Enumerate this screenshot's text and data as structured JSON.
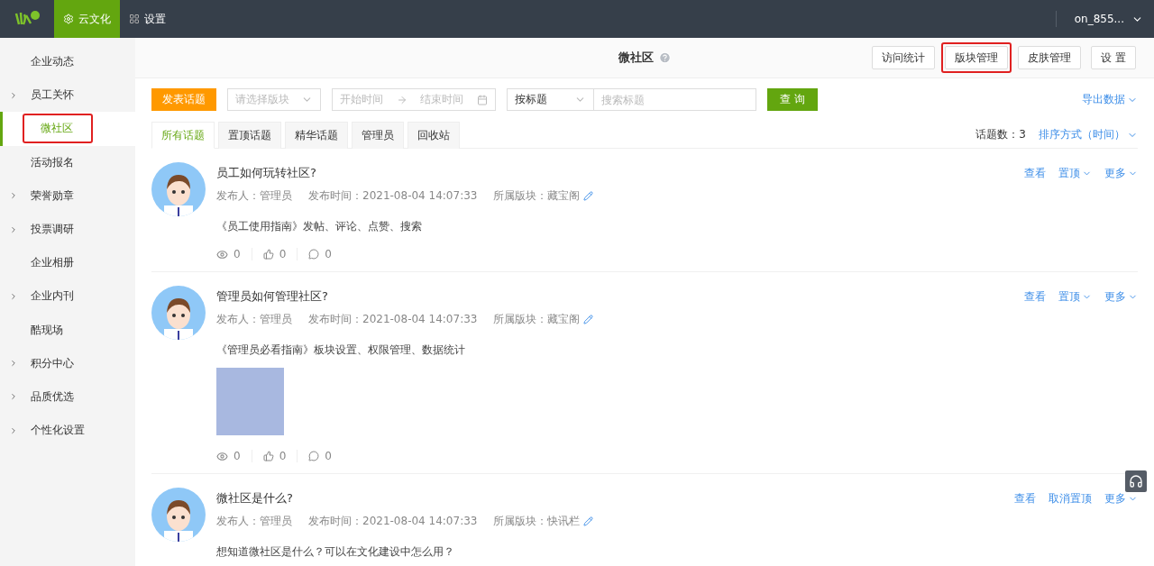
{
  "topbar": {
    "nav": [
      {
        "label": "云文化",
        "selected": true
      },
      {
        "label": "设置",
        "selected": false
      }
    ],
    "user": "on_855..."
  },
  "sidebar": {
    "items": [
      {
        "label": "企业动态",
        "expandable": false,
        "selected": false,
        "highlighted": false
      },
      {
        "label": "员工关怀",
        "expandable": true,
        "selected": false,
        "highlighted": false
      },
      {
        "label": "微社区",
        "expandable": false,
        "selected": true,
        "highlighted": true
      },
      {
        "label": "活动报名",
        "expandable": false,
        "selected": false,
        "highlighted": false
      },
      {
        "label": "荣誉勋章",
        "expandable": true,
        "selected": false,
        "highlighted": false
      },
      {
        "label": "投票调研",
        "expandable": true,
        "selected": false,
        "highlighted": false
      },
      {
        "label": "企业相册",
        "expandable": false,
        "selected": false,
        "highlighted": false
      },
      {
        "label": "企业内刊",
        "expandable": true,
        "selected": false,
        "highlighted": false
      },
      {
        "label": "酷现场",
        "expandable": false,
        "selected": false,
        "highlighted": false
      },
      {
        "label": "积分中心",
        "expandable": true,
        "selected": false,
        "highlighted": false
      },
      {
        "label": "品质优选",
        "expandable": true,
        "selected": false,
        "highlighted": false
      },
      {
        "label": "个性化设置",
        "expandable": true,
        "selected": false,
        "highlighted": false
      }
    ]
  },
  "header": {
    "title": "微社区",
    "buttons": [
      {
        "label": "访问统计",
        "highlighted": false
      },
      {
        "label": "版块管理",
        "highlighted": true
      },
      {
        "label": "皮肤管理",
        "highlighted": false
      },
      {
        "label": "设 置",
        "highlighted": false
      }
    ]
  },
  "toolbar": {
    "post_button": "发表话题",
    "section_select": {
      "placeholder": "请选择版块"
    },
    "start_time": {
      "placeholder": "开始时间"
    },
    "end_time": {
      "placeholder": "结束时间"
    },
    "search_by": "按标题",
    "search": {
      "placeholder": "搜索标题"
    },
    "query_button": "查 询",
    "export": "导出数据"
  },
  "tabs": [
    {
      "label": "所有话题",
      "selected": true
    },
    {
      "label": "置顶话题",
      "selected": false
    },
    {
      "label": "精华话题",
      "selected": false
    },
    {
      "label": "管理员",
      "selected": false
    },
    {
      "label": "回收站",
      "selected": false
    }
  ],
  "topic_count": "话题数：3",
  "sort": "排序方式（时间）",
  "posts": [
    {
      "title": "员工如何玩转社区?",
      "author": "发布人：管理员",
      "time": "发布时间：2021-08-04 14:07:33",
      "section": "所属版块：藏宝阁",
      "body": "《员工使用指南》发帖、评论、点赞、搜索",
      "has_image": false,
      "views": "0",
      "likes": "0",
      "comments": "0",
      "actions": [
        {
          "label": "查看",
          "dropdown": false
        },
        {
          "label": "置顶",
          "dropdown": true
        },
        {
          "label": "更多",
          "dropdown": true
        }
      ]
    },
    {
      "title": "管理员如何管理社区?",
      "author": "发布人：管理员",
      "time": "发布时间：2021-08-04 14:07:33",
      "section": "所属版块：藏宝阁",
      "body": "《管理员必看指南》板块设置、权限管理、数据统计",
      "has_image": true,
      "views": "0",
      "likes": "0",
      "comments": "0",
      "actions": [
        {
          "label": "查看",
          "dropdown": false
        },
        {
          "label": "置顶",
          "dropdown": true
        },
        {
          "label": "更多",
          "dropdown": true
        }
      ]
    },
    {
      "title": "微社区是什么?",
      "author": "发布人：管理员",
      "time": "发布时间：2021-08-04 14:07:33",
      "section": "所属版块：快讯栏",
      "body": "想知道微社区是什么？可以在文化建设中怎么用？",
      "has_image": false,
      "actions": [
        {
          "label": "查看",
          "dropdown": false
        },
        {
          "label": "取消置顶",
          "dropdown": false
        },
        {
          "label": "更多",
          "dropdown": true
        }
      ]
    }
  ]
}
